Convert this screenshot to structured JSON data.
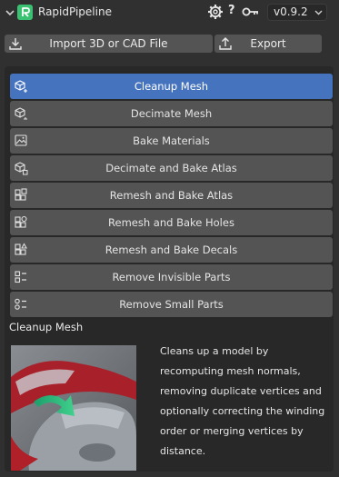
{
  "header": {
    "app_title": "RapidPipeline",
    "help_label": "?",
    "version": "v0.9.2"
  },
  "toolbar": {
    "import_label": "Import 3D or CAD File",
    "export_label": "Export"
  },
  "menu": {
    "items": [
      {
        "label": "Cleanup Mesh",
        "icon": "cube-sparkle-icon",
        "active": true
      },
      {
        "label": "Decimate Mesh",
        "icon": "cube-minus-icon",
        "active": false
      },
      {
        "label": "Bake Materials",
        "icon": "image-texture-icon",
        "active": false
      },
      {
        "label": "Decimate and Bake Atlas",
        "icon": "cube-atlas-icon",
        "active": false
      },
      {
        "label": "Remesh and Bake Atlas",
        "icon": "remesh-atlas-icon",
        "active": false
      },
      {
        "label": "Remesh and Bake Holes",
        "icon": "remesh-holes-icon",
        "active": false
      },
      {
        "label": "Remesh and Bake Decals",
        "icon": "remesh-decals-icon",
        "active": false
      },
      {
        "label": "Remove Invisible Parts",
        "icon": "remove-invisible-icon",
        "active": false
      },
      {
        "label": "Remove Small Parts",
        "icon": "remove-small-icon",
        "active": false
      }
    ]
  },
  "detail": {
    "title": "Cleanup Mesh",
    "description": "Cleans up a model by recomputing mesh normals, removing duplicate vertices and optionally correcting the winding order or merging vertices by distance."
  },
  "colors": {
    "accent": "#4673bd",
    "brand": "#3bc172",
    "background": "#303030",
    "panel": "#282828",
    "button": "#545454"
  }
}
